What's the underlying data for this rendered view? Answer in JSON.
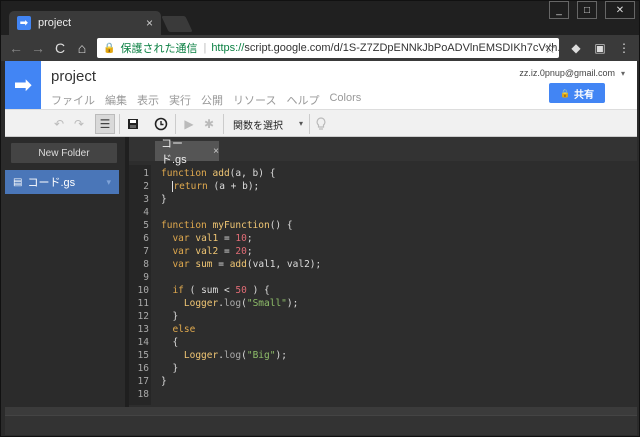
{
  "browser": {
    "tab_title": "project",
    "tab_close": "×",
    "favicon": "➡",
    "window_controls": {
      "minimize": "_",
      "maximize": "□",
      "close": "✕"
    },
    "back": "←",
    "forward": "→",
    "reload": "C",
    "home": "⌂",
    "lock_icon": "🔒",
    "secure_label": "保護された通信",
    "url_scheme": "https://",
    "url_rest": "script.google.com/d/1S-Z7ZDpENNkJbPoADVlnEMSDIKh7cVxh...",
    "star": "☆",
    "menu": "⋮"
  },
  "header": {
    "logo": "➡",
    "title": "project",
    "menus": [
      "ファイル",
      "編集",
      "表示",
      "実行",
      "公開",
      "リソース",
      "ヘルプ",
      "Colors"
    ],
    "account": "zz.iz.0pnup@gmail.com",
    "account_caret": "▾",
    "share_icon": "🔒",
    "share_label": "共有"
  },
  "toolbar": {
    "undo": "↶",
    "redo": "↷",
    "indent": "☰",
    "save": "💾",
    "triggers": "◷",
    "run": "▶",
    "debug": "✱",
    "function_select": "関数を選択",
    "function_caret": "▾",
    "hint": "💡"
  },
  "sidebar": {
    "new_folder": "New Folder",
    "file_icon": "▤",
    "file_name": "コード.gs",
    "file_caret": "▾"
  },
  "editor": {
    "tab_label": "コード.gs",
    "tab_close": "×",
    "line_numbers": [
      "1",
      "2",
      "3",
      "4",
      "5",
      "6",
      "7",
      "8",
      "9",
      "10",
      "11",
      "12",
      "13",
      "14",
      "15",
      "16",
      "17",
      "18"
    ]
  }
}
